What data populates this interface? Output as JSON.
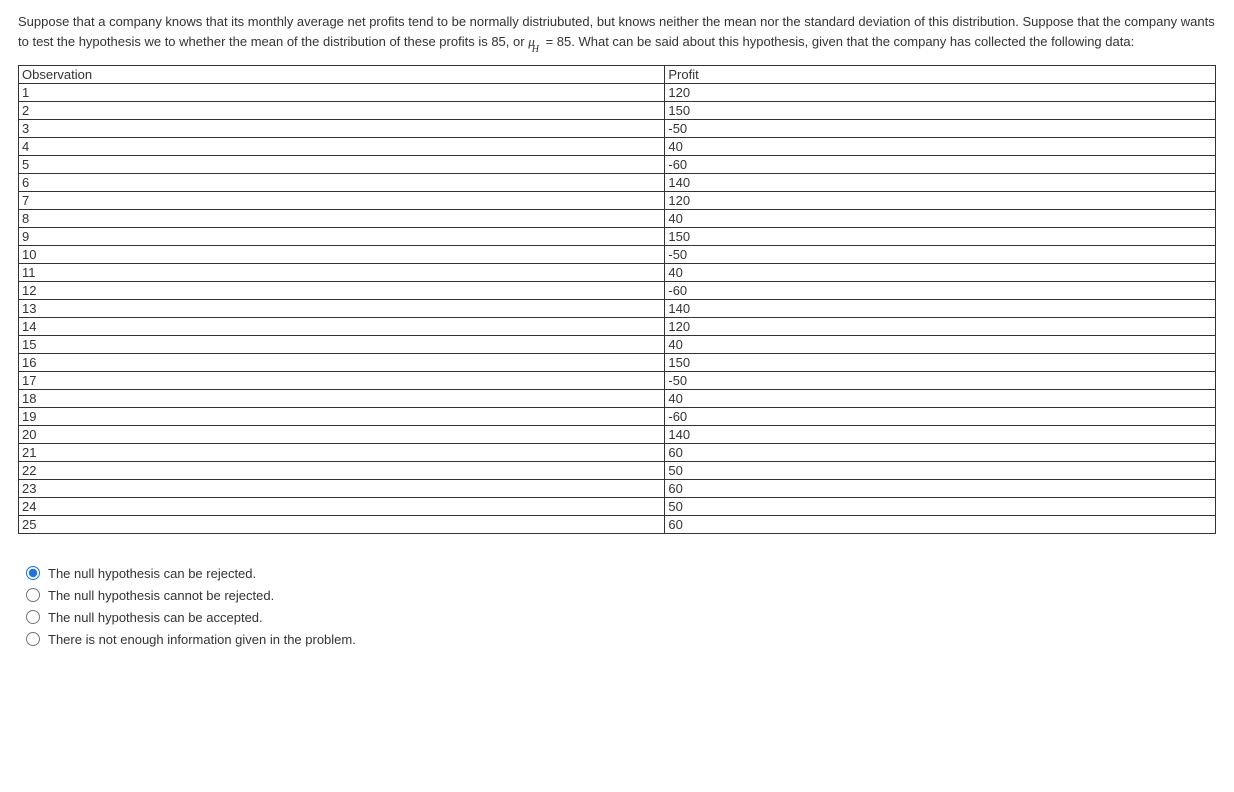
{
  "question": {
    "segments": [
      "Suppose that a company knows that its monthly average net profits tend to be normally distriubuted, but knows neither the mean nor the standard deviation of this distribution. Suppose that the company wants to test the hypothesis we to whether the mean of the distribution of these profits is 85, or ",
      " = 85",
      ". What can be said about this hypothesis, given that the company has collected the following data:"
    ],
    "mu": "μ",
    "sub": "H"
  },
  "table": {
    "head": {
      "obs": "Observation",
      "profit": "Profit"
    },
    "rows": [
      {
        "obs": "1",
        "profit": "120"
      },
      {
        "obs": "2",
        "profit": "150"
      },
      {
        "obs": "3",
        "profit": "-50"
      },
      {
        "obs": "4",
        "profit": "40"
      },
      {
        "obs": "5",
        "profit": "-60"
      },
      {
        "obs": "6",
        "profit": "140"
      },
      {
        "obs": "7",
        "profit": "120"
      },
      {
        "obs": "8",
        "profit": "40"
      },
      {
        "obs": "9",
        "profit": "150"
      },
      {
        "obs": "10",
        "profit": "-50"
      },
      {
        "obs": "11",
        "profit": "40"
      },
      {
        "obs": "12",
        "profit": "-60"
      },
      {
        "obs": "13",
        "profit": "140"
      },
      {
        "obs": "14",
        "profit": "120"
      },
      {
        "obs": "15",
        "profit": "40"
      },
      {
        "obs": "16",
        "profit": "150"
      },
      {
        "obs": "17",
        "profit": "-50"
      },
      {
        "obs": "18",
        "profit": "40"
      },
      {
        "obs": "19",
        "profit": "-60"
      },
      {
        "obs": "20",
        "profit": "140"
      },
      {
        "obs": "21",
        "profit": "60"
      },
      {
        "obs": "22",
        "profit": "50"
      },
      {
        "obs": "23",
        "profit": "60"
      },
      {
        "obs": "24",
        "profit": "50"
      },
      {
        "obs": "25",
        "profit": "60"
      }
    ]
  },
  "options": [
    {
      "label": "The null hypothesis can be rejected.",
      "selected": true
    },
    {
      "label": "The null hypothesis cannot be rejected.",
      "selected": false
    },
    {
      "label": "The null hypothesis can be accepted.",
      "selected": false
    },
    {
      "label": "There is not enough information given in the problem.",
      "selected": false
    }
  ]
}
